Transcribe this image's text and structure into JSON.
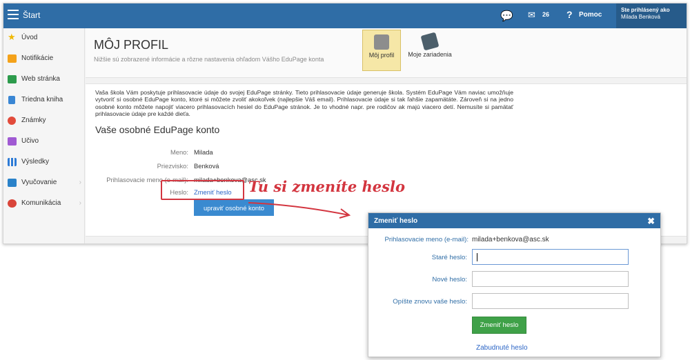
{
  "topbar": {
    "title": "Štart",
    "mail_count": "26",
    "help": "Pomoc",
    "user_status": "Ste prihlásený ako",
    "user_name": "Milada Benková"
  },
  "sidebar": {
    "items": [
      {
        "label": "Úvod",
        "icon": "star-icon",
        "color": "#f0b800"
      },
      {
        "label": "Notifikácie",
        "icon": "envelope-icon",
        "color": "#f4a21a"
      },
      {
        "label": "Web stránka",
        "icon": "house-icon",
        "color": "#2d9b4c"
      },
      {
        "label": "Triedna kniha",
        "icon": "book-icon",
        "color": "#3a86d4"
      },
      {
        "label": "Známky",
        "icon": "grades-icon",
        "color": "#e24b3b"
      },
      {
        "label": "Učivo",
        "icon": "teacher-icon",
        "color": "#a05ad3"
      },
      {
        "label": "Výsledky",
        "icon": "bar-chart-icon",
        "color": "#2d7bd6"
      },
      {
        "label": "Vyučovanie",
        "icon": "lesson-icon",
        "color": "#2a82c9"
      },
      {
        "label": "Komunikácia",
        "icon": "chat-bubbles-icon",
        "color": "#d9453a"
      }
    ]
  },
  "header": {
    "title": "MÔJ PROFIL",
    "subtitle": "Nižšie sú zobrazené informácie a rôzne nastavenia ohľadom Vášho EduPage konta",
    "tiles": {
      "profile": "Môj profil",
      "devices": "Moje zariadenia"
    }
  },
  "content": {
    "intro": "Vaša škola Vám poskytuje prihlasovacie údaje do svojej EduPage stránky. Tieto prihlasovacie údaje generuje škola. Systém EduPage Vám naviac umožňuje vytvoriť si osobné EduPage konto, ktoré si môžete zvoliť akokoľvek (najlepšie Váš email). Prihlasovacie údaje si tak ľahšie zapamätáte. Zároveň si na jedno osobné konto môžete napojiť viacero prihlasovacích hesiel do EduPage stránok. Je to vhodné napr. pre rodičov ak majú viacero detí. Nemusíte si pamätať prihlasovacie údaje pre každé dieťa.",
    "section_title": "Vaše osobné EduPage konto",
    "fields": {
      "name_label": "Meno:",
      "name_value": "Milada",
      "surname_label": "Priezvisko:",
      "surname_value": "Benková",
      "login_label": "Prihlasovacie meno (e-mail):",
      "login_value": "milada+benkova@asc.sk",
      "password_label": "Heslo:",
      "password_link": "Zmeniť heslo"
    },
    "edit_button": "upraviť osobné konto"
  },
  "annotation": {
    "text": "Tu si zmeníte heslo",
    "color": "#d3353f"
  },
  "dialog": {
    "title": "Zmeniť heslo",
    "login_label": "Prihlasovacie meno (e-mail):",
    "login_value": "milada+benkova@asc.sk",
    "old_label": "Staré heslo:",
    "new_label": "Nové heslo:",
    "repeat_label": "Opíšte znovu vaše heslo:",
    "submit": "Zmeniť heslo",
    "forgot": "Zabudnuté heslo"
  },
  "colors": {
    "accent": "#2f6da6",
    "submit": "#3fa148",
    "edit_button": "#3a8ad0",
    "highlight": "#f6e7a7"
  }
}
